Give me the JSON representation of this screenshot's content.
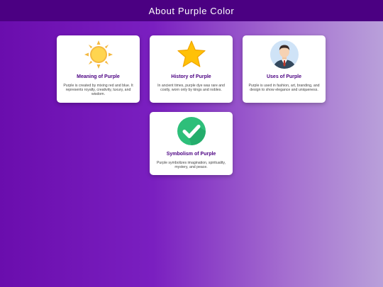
{
  "header": {
    "title": "About Purple Color"
  },
  "cards": [
    {
      "icon": "sun-icon",
      "title": "Meaning of Purple",
      "description": "Purple is created by mixing red and blue. It represents royalty, creativity, luxury, and wisdom."
    },
    {
      "icon": "star-icon",
      "title": "History of Purple",
      "description": "In ancient times, purple dye was rare and costly, worn only by kings and nobles."
    },
    {
      "icon": "businessman-avatar-icon",
      "title": "Uses of Purple",
      "description": "Purple is used in fashion, art, branding, and design to show elegance and uniqueness."
    },
    {
      "icon": "checkmark-circle-icon",
      "title": "Symbolism of Purple",
      "description": "Purple symbolizes imagination, spirituality, mystery, and peace."
    }
  ],
  "colors": {
    "header_bg": "#4b0082",
    "title_text": "#4b0082",
    "background_start": "#6a0dad",
    "background_end": "#b9a0da"
  }
}
